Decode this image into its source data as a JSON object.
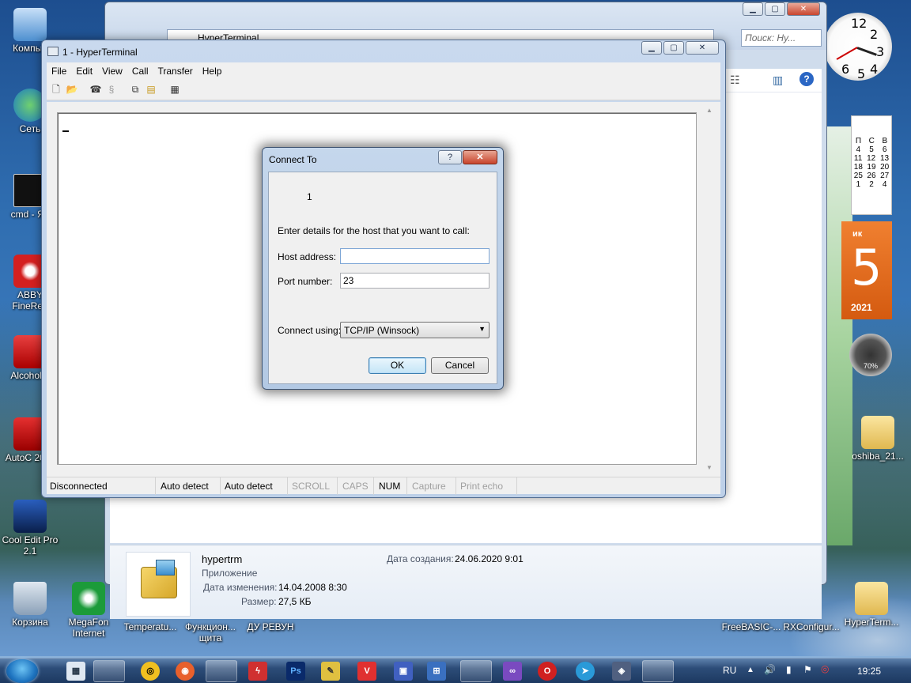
{
  "desktop": {
    "icons": [
      {
        "label": "Компью"
      },
      {
        "label": "Сеть"
      },
      {
        "label": "cmd - Яр"
      },
      {
        "label": "ABBY FineRea"
      },
      {
        "label": "Alcohol 1"
      },
      {
        "label": "AutoC 2011"
      },
      {
        "label": "Cool Edit Pro 2.1"
      },
      {
        "label": "Корзина"
      },
      {
        "label": "MegaFon Internet"
      },
      {
        "label": "Temperatu..."
      },
      {
        "label": "Функцион... щита"
      },
      {
        "label": "ДУ РЕВУН"
      },
      {
        "label": "FreeBASIC-..."
      },
      {
        "label": "RXConfigur..."
      },
      {
        "label": "HyperTerm..."
      },
      {
        "label": "oshiba_21..."
      }
    ]
  },
  "explorer": {
    "path": "HyperTerminal",
    "search_placeholder": "Поиск: Ну...",
    "details": {
      "name": "hypertrm",
      "type": "Приложение",
      "modified_label": "Дата изменения:",
      "modified_value": "14.04.2008 8:30",
      "size_label": "Размер:",
      "size_value": "27,5 КБ",
      "created_label": "Дата создания:",
      "created_value": "24.06.2020 9:01"
    }
  },
  "gadgets": {
    "clock_numbers": [
      "12",
      "2",
      "3",
      "4",
      "5",
      "6"
    ],
    "calendar_head": [
      "П",
      "С",
      "В"
    ],
    "calendar_rows": [
      [
        "4",
        "5",
        "6"
      ],
      [
        "11",
        "12",
        "13"
      ],
      [
        "18",
        "19",
        "20"
      ],
      [
        "25",
        "26",
        "27"
      ],
      [
        "1",
        "2",
        "4"
      ]
    ],
    "big_day_label": "ик",
    "big_day": "5",
    "big_year": "2021",
    "meter_value": "70%"
  },
  "hyperterminal": {
    "title": "1 - HyperTerminal",
    "menu": [
      "File",
      "Edit",
      "View",
      "Call",
      "Transfer",
      "Help"
    ],
    "status": {
      "connection": "Disconnected",
      "detect1": "Auto detect",
      "detect2": "Auto detect",
      "scroll": "SCROLL",
      "caps": "CAPS",
      "num": "NUM",
      "capture": "Capture",
      "print_echo": "Print echo"
    }
  },
  "dialog": {
    "title": "Connect To",
    "help_label": "?",
    "close_label": "✕",
    "connection_name": "1",
    "instructions": "Enter details for the host that you want to call:",
    "host_label": "Host address:",
    "host_value": "",
    "port_label": "Port number:",
    "port_value": "23",
    "connect_label": "Connect using:",
    "connect_value": "TCP/IP (Winsock)",
    "ok_label": "OK",
    "cancel_label": "Cancel"
  },
  "taskbar": {
    "language": "RU",
    "time": "19:25"
  }
}
